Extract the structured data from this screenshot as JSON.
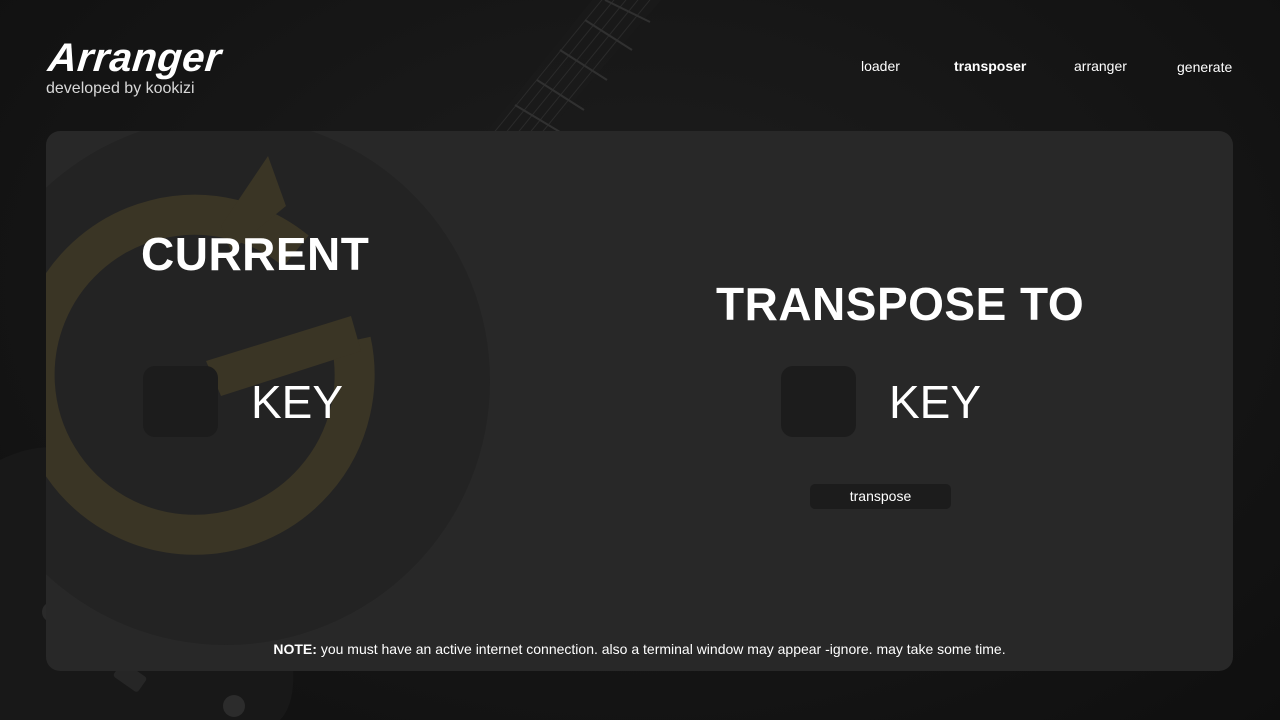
{
  "app": {
    "title": "Arranger",
    "subtitle": "developed by kookizi"
  },
  "nav": {
    "items": [
      {
        "label": "loader",
        "active": false
      },
      {
        "label": "transposer",
        "active": true
      },
      {
        "label": "arranger",
        "active": false
      },
      {
        "label": "generate",
        "active": false
      }
    ]
  },
  "main": {
    "current_heading": "CURRENT",
    "current_key_label": "KEY",
    "target_heading": "TRANSPOSE TO",
    "target_key_label": "KEY",
    "transpose_button": "transpose",
    "note_prefix": "NOTE:",
    "note_text": " you must have an active internet connection. also a terminal window may appear -ignore. may take some time."
  },
  "colors": {
    "background": "#141414",
    "panel": "#282828",
    "key_box": "#1c1c1c",
    "logo_accent": "#3a3525"
  }
}
